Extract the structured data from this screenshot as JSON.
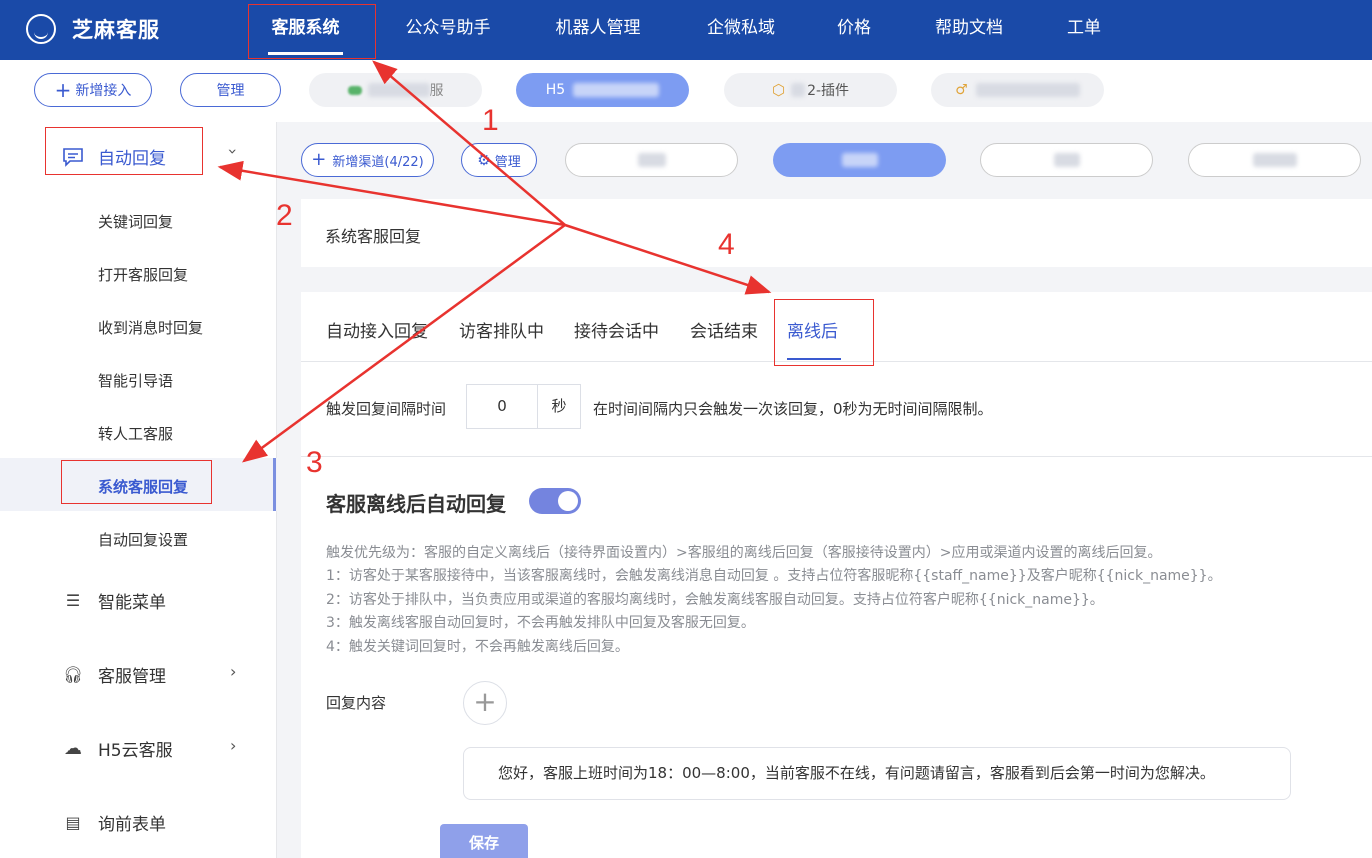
{
  "brand": {
    "name": "芝麻客服",
    "logo_icon": "smile-bubble-icon"
  },
  "top_nav": [
    {
      "label": "客服系统",
      "active": true
    },
    {
      "label": "公众号助手"
    },
    {
      "label": "机器人管理"
    },
    {
      "label": "企微私域"
    },
    {
      "label": "价格"
    },
    {
      "label": "帮助文档"
    },
    {
      "label": "工单"
    }
  ],
  "app_bar": {
    "add_label": "新增接入",
    "manage_label": "管理",
    "channels": [
      {
        "label": "服",
        "icon": "chat-icon"
      },
      {
        "label": "H5",
        "active": true
      },
      {
        "label": "2-插件",
        "icon": "cube-icon"
      },
      {
        "label": "",
        "icon": "link-icon"
      }
    ]
  },
  "channel_bar": {
    "add_label": "新增渠道(4/22)",
    "manage_label": "管理"
  },
  "sidebar": {
    "head": "自动回复",
    "sub_items": [
      "关键词回复",
      "打开客服回复",
      "收到消息时回复",
      "智能引导语",
      "转人工客服",
      "系统客服回复",
      "自动回复设置"
    ],
    "groups": [
      {
        "label": "智能菜单",
        "icon": "list-icon"
      },
      {
        "label": "客服管理",
        "icon": "headset-icon"
      },
      {
        "label": "H5云客服",
        "icon": "cloud-icon"
      },
      {
        "label": "询前表单",
        "icon": "form-icon"
      }
    ]
  },
  "page": {
    "title": "系统客服回复",
    "tabs": [
      "自动接入回复",
      "访客排队中",
      "接待会话中",
      "会话结束",
      "离线后"
    ],
    "interval_label": "触发回复间隔时间",
    "interval_value": "0",
    "interval_unit": "秒",
    "interval_hint": "在时间间隔内只会触发一次该回复，0秒为无时间间隔限制。",
    "section_title": "客服离线后自动回复",
    "toggle_on": true,
    "rules": [
      "触发优先级为：客服的自定义离线后（接待界面设置内）>客服组的离线后回复（客服接待设置内）>应用或渠道内设置的离线后回复。",
      "1：访客处于某客服接待中，当该客服离线时，会触发离线消息自动回复 。支持占位符客服昵称{{staff_name}}及客户昵称{{nick_name}}。",
      "2：访客处于排队中，当负责应用或渠道的客服均离线时，会触发离线客服自动回复。支持占位符客户昵称{{nick_name}}。",
      "3：触发离线客服自动回复时，不会再触发排队中回复及客服无回复。",
      "4：触发关键词回复时，不会再触发离线后回复。"
    ],
    "reply_label": "回复内容",
    "reply_text": "您好，客服上班时间为18：00—8:00，当前客服不在线，有问题请留言，客服看到后会第一时间为您解决。",
    "save_label": "保存"
  },
  "annotations": {
    "numbers": [
      "1",
      "2",
      "3",
      "4"
    ],
    "color": "#e8332f"
  }
}
